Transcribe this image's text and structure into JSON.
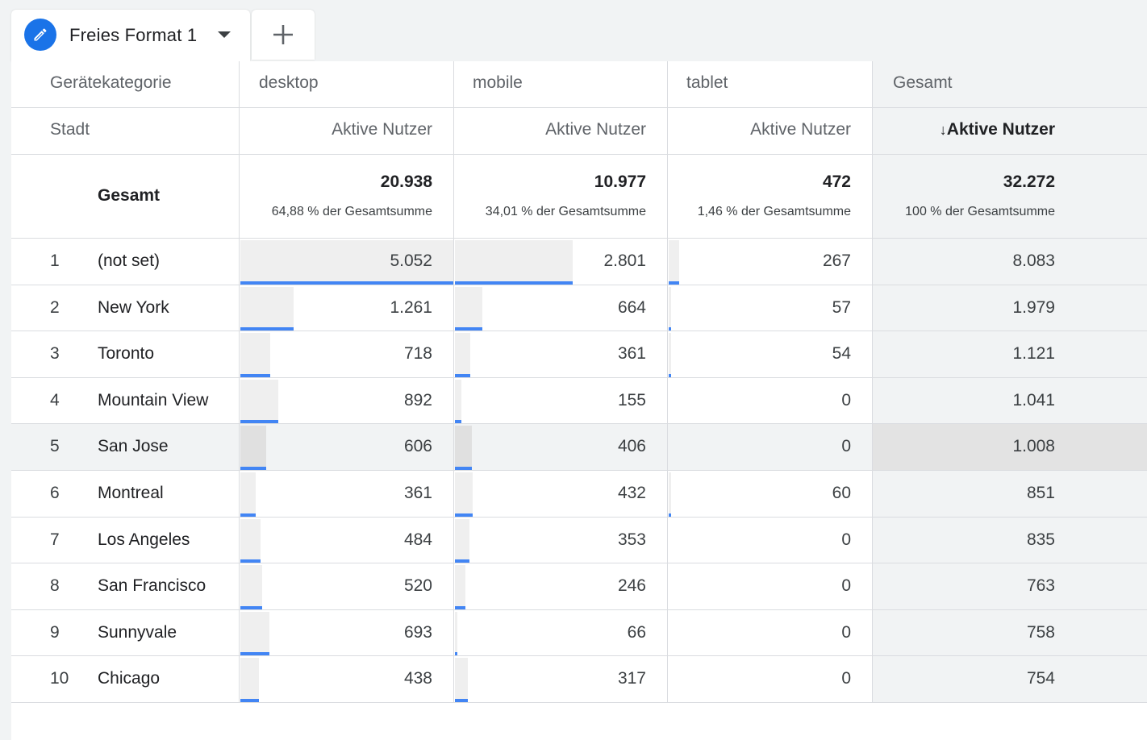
{
  "tab": {
    "label": "Freies Format 1"
  },
  "header": {
    "dimension1": "Gerätekategorie",
    "columns": [
      "desktop",
      "mobile",
      "tablet",
      "Gesamt"
    ],
    "dimension2": "Stadt",
    "metric": "Aktive Nutzer",
    "sort_arrow": "↓"
  },
  "totals": {
    "label": "Gesamt",
    "values": [
      "20.938",
      "10.977",
      "472",
      "32.272"
    ],
    "shares": [
      "64,88 % der Gesamtsumme",
      "34,01 % der Gesamtsumme",
      "1,46 % der Gesamtsumme",
      "100 % der Gesamtsumme"
    ]
  },
  "rows": [
    {
      "rank": "1",
      "city": "(not set)",
      "desktop": "5.052",
      "mobile": "2.801",
      "tablet": "267",
      "total": "8.083",
      "bar_fraction": [
        1.0,
        0.554,
        0.0528
      ]
    },
    {
      "rank": "2",
      "city": "New York",
      "desktop": "1.261",
      "mobile": "664",
      "tablet": "57",
      "total": "1.979",
      "bar_fraction": [
        0.25,
        0.131,
        0.0113
      ]
    },
    {
      "rank": "3",
      "city": "Toronto",
      "desktop": "718",
      "mobile": "361",
      "tablet": "54",
      "total": "1.121",
      "bar_fraction": [
        0.142,
        0.0715,
        0.0107
      ]
    },
    {
      "rank": "4",
      "city": "Mountain View",
      "desktop": "892",
      "mobile": "155",
      "tablet": "0",
      "total": "1.041",
      "bar_fraction": [
        0.177,
        0.0307,
        0
      ]
    },
    {
      "rank": "5",
      "city": "San Jose",
      "desktop": "606",
      "mobile": "406",
      "tablet": "0",
      "total": "1.008",
      "bar_fraction": [
        0.12,
        0.0804,
        0
      ],
      "highlighted": true
    },
    {
      "rank": "6",
      "city": "Montreal",
      "desktop": "361",
      "mobile": "432",
      "tablet": "60",
      "total": "851",
      "bar_fraction": [
        0.0715,
        0.0855,
        0.0119
      ]
    },
    {
      "rank": "7",
      "city": "Los Angeles",
      "desktop": "484",
      "mobile": "353",
      "tablet": "0",
      "total": "835",
      "bar_fraction": [
        0.0958,
        0.0699,
        0
      ]
    },
    {
      "rank": "8",
      "city": "San Francisco",
      "desktop": "520",
      "mobile": "246",
      "tablet": "0",
      "total": "763",
      "bar_fraction": [
        0.103,
        0.0487,
        0
      ]
    },
    {
      "rank": "9",
      "city": "Sunnyvale",
      "desktop": "693",
      "mobile": "66",
      "tablet": "0",
      "total": "758",
      "bar_fraction": [
        0.137,
        0.0131,
        0
      ]
    },
    {
      "rank": "10",
      "city": "Chicago",
      "desktop": "438",
      "mobile": "317",
      "tablet": "0",
      "total": "754",
      "bar_fraction": [
        0.0867,
        0.0627,
        0
      ]
    }
  ],
  "colors": {
    "accent": "#1a73e8",
    "bar_line": "#4285f4",
    "bar_fill": "#efefef",
    "header_bg": "#f1f3f4"
  },
  "icons": {
    "tab_icon": "pencil-icon",
    "add_tab": "plus-icon",
    "tab_menu": "caret-down-icon",
    "sort": "arrow-down-icon"
  }
}
